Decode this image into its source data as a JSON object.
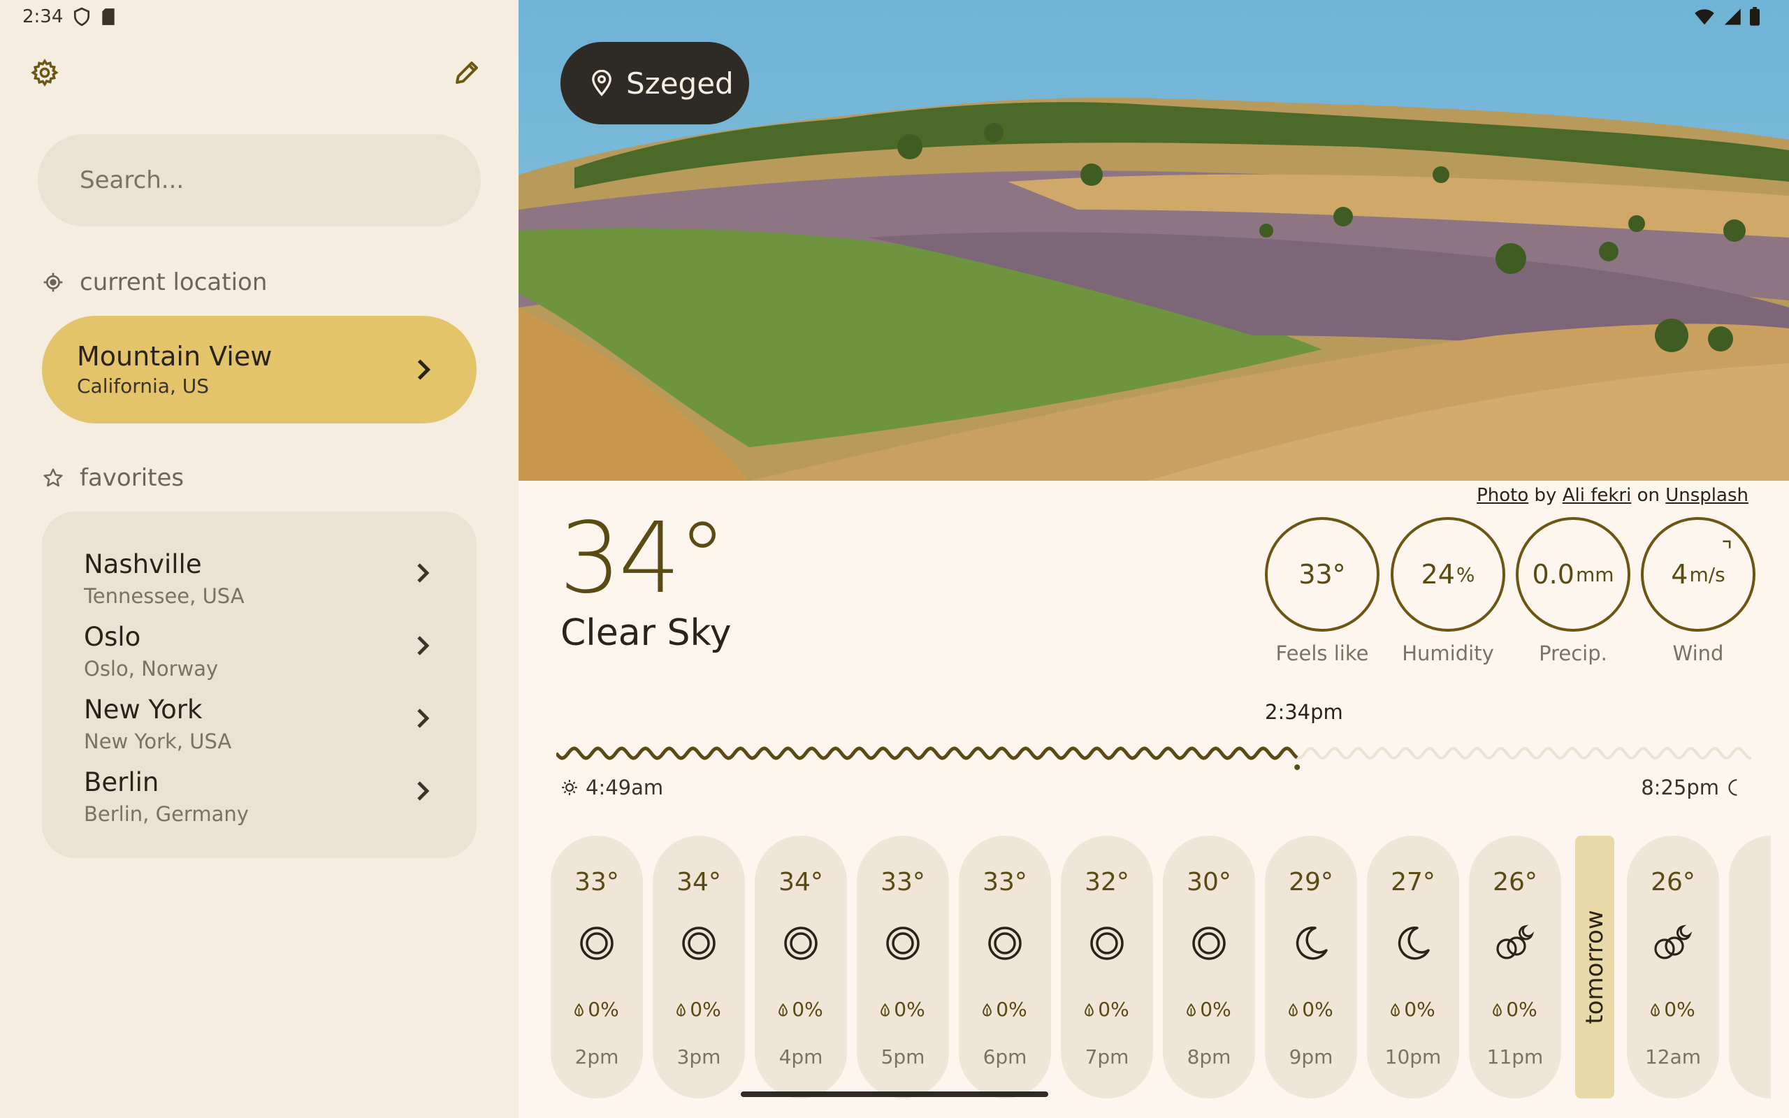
{
  "status_bar": {
    "time": "2:34"
  },
  "sidebar": {
    "search_placeholder": "Search...",
    "current_label": "current location",
    "current": {
      "name": "Mountain View",
      "sub": "California, US"
    },
    "favorites_label": "favorites",
    "favorites": [
      {
        "name": "Nashville",
        "sub": "Tennessee, USA"
      },
      {
        "name": "Oslo",
        "sub": "Oslo, Norway"
      },
      {
        "name": "New York",
        "sub": "New York, USA"
      },
      {
        "name": "Berlin",
        "sub": "Berlin, Germany"
      }
    ]
  },
  "main": {
    "location": "Szeged",
    "credit": {
      "photo": "Photo",
      "by": "by",
      "author": "Ali fekri",
      "on": "on",
      "site": "Unsplash"
    },
    "temperature": "34°",
    "condition": "Clear Sky",
    "metrics": [
      {
        "value": "33°",
        "unit": "",
        "label": "Feels like"
      },
      {
        "value": "24",
        "unit": "%",
        "label": "Humidity"
      },
      {
        "value": "0.0",
        "unit": "mm",
        "label": "Precip."
      },
      {
        "value": "4",
        "unit": "m/s",
        "label": "Wind"
      }
    ],
    "now_time": "2:34pm",
    "day_progress": 0.62,
    "sunrise": "4:49am",
    "sunset": "8:25pm",
    "tomorrow_label": "tomorrow",
    "hourly": [
      {
        "temp": "33°",
        "icon": "sun-icon",
        "precip": "0%",
        "hour": "2pm"
      },
      {
        "temp": "34°",
        "icon": "sun-icon",
        "precip": "0%",
        "hour": "3pm"
      },
      {
        "temp": "34°",
        "icon": "sun-icon",
        "precip": "0%",
        "hour": "4pm"
      },
      {
        "temp": "33°",
        "icon": "sun-icon",
        "precip": "0%",
        "hour": "5pm"
      },
      {
        "temp": "33°",
        "icon": "sun-icon",
        "precip": "0%",
        "hour": "6pm"
      },
      {
        "temp": "32°",
        "icon": "sun-icon",
        "precip": "0%",
        "hour": "7pm"
      },
      {
        "temp": "30°",
        "icon": "sun-icon",
        "precip": "0%",
        "hour": "8pm"
      },
      {
        "temp": "29°",
        "icon": "moon-icon",
        "precip": "0%",
        "hour": "9pm"
      },
      {
        "temp": "27°",
        "icon": "moon-icon",
        "precip": "0%",
        "hour": "10pm"
      },
      {
        "temp": "26°",
        "icon": "partly-cloudy-night-icon",
        "precip": "0%",
        "hour": "11pm"
      },
      {
        "temp": "26°",
        "icon": "partly-cloudy-night-icon",
        "precip": "0%",
        "hour": "12am"
      }
    ]
  },
  "colors": {
    "accent": "#e3c46b",
    "ink": "#5a4a14",
    "panel": "#f5ede0",
    "pill": "#2e2a25"
  }
}
